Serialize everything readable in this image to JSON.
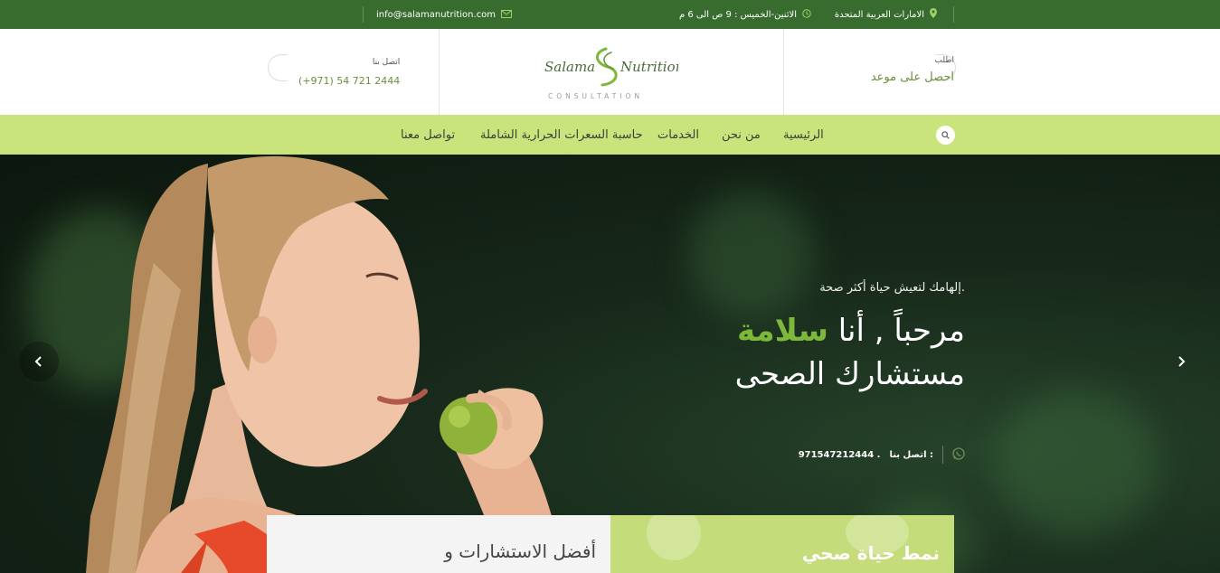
{
  "topbar": {
    "location": "الامارات العربية المتحدة",
    "hours": "الاثنين-الخميس : 9 ص الى 6 م",
    "email": "info@salamanutrition.com"
  },
  "header": {
    "appointment_small": "اطلب",
    "appointment_big": "احصل على موعد",
    "contact_small": "اتصل بنا",
    "contact_phone": "(+971) 54 721 2444",
    "logo_left": "Salama",
    "logo_right": "Nutrition",
    "logo_sub": "CONSULTATION"
  },
  "nav": {
    "items": [
      "الرئيسية",
      "من نحن",
      "الخدمات",
      "حاسبة السعرات الحرارية الشاملة",
      "تواصل معنا"
    ]
  },
  "hero": {
    "tagline": "إلهامك لتعيش حياة أكثر صحة.",
    "headline_prefix": "مرحباً , أنا",
    "headline_highlight": "سلامة",
    "headline_line2": "مستشارك الصحى",
    "contact_label": "اتصل بنا :",
    "contact_number": "971547212444 ."
  },
  "boxes": {
    "left_text": "أفضل الاستشارات و",
    "right_text": "نمط حياة صحي"
  },
  "colors": {
    "topbar": "#386b2e",
    "nav": "#c9e47b",
    "accent": "#7db83a"
  }
}
